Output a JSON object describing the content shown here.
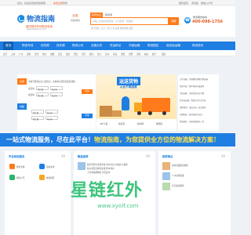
{
  "topbar": {
    "welcome": "您好，欢迎来到物流指南网",
    "links": [
      "免费注册",
      "登录",
      "客服中心"
    ],
    "right_links": [
      "服务首页",
      "手机版",
      "微信公众号",
      "网站导航"
    ]
  },
  "header": {
    "site_name": "物流指南",
    "slogan": "国内物流专线物流查询",
    "url": "www.wlzhinan.com",
    "city": "全国",
    "switch_city": "切换城市",
    "search_tabs": [
      "物流信息",
      "搜货源"
    ],
    "search_placeholder": "请输入出发地/目的地、公司名称、线路等",
    "search_button": "搜索",
    "hotwords": "热门搜索：北京 上海 广州 深圳 物流专线 货运",
    "hotline_label": "物流服务热线",
    "hotline_number": "400-098-1756",
    "hotline_icon": "phone-icon"
  },
  "nav": {
    "items": [
      "首页",
      "物流专线",
      "找货源",
      "找车源",
      "物流公司",
      "全国大件",
      "货运网点",
      "冷链运输",
      "物流园区",
      "危险品运输",
      "物流资讯"
    ]
  },
  "subnav": {
    "items": [
      "北京",
      "上海",
      "广州",
      "深圳",
      "天津",
      "杭州",
      "成都",
      "武汉",
      "重庆",
      "西安",
      "南京",
      "郑州",
      "长沙",
      "苏州",
      "青岛",
      "沈阳",
      "合肥",
      "济南",
      "福州",
      "厦门",
      "更多"
    ]
  },
  "form": {
    "tab1": "货源",
    "tab2": "线路",
    "hint": "请填写物流起点以及终点，系统将为您匹配最优线路",
    "from_label": "发货地",
    "to_label": "收货地",
    "province_from": "浙江省",
    "city_from": "杭州市",
    "province_to": "浙江省",
    "city_to": "杭州市",
    "query_button": "查询",
    "query_button2": "查询"
  },
  "banner": {
    "title": "运送货物",
    "subtitle": "从此不再困难",
    "tabs": [
      "APP下载",
      "找货源",
      "找车辆",
      "物流园"
    ]
  },
  "news": {
    "items": [
      "大件运输：不超重不超限货物运输",
      "物流专线：整车零担价格透明",
      "冷链运输：全程温控安全可靠",
      "危险品运输：资质齐全专业车队",
      "国际物流：海运空运一站式服务",
      "仓储配送：城市配送当日达",
      "物流园区：全国百家园区入驻"
    ]
  },
  "strip": {
    "text_before": "一站式物流服务，尽在此平台！",
    "text_highlight": "物流指南，为您提供全方位的物流解决方案！"
  },
  "columns": {
    "col1_title": "平台特色服务",
    "col2_title": "精品推荐",
    "col3_title": "推荐网点",
    "more": "更多",
    "col1_items": [
      "物流专线",
      "货运车源",
      "物流公司",
      "物流园区"
    ],
    "col2_items": [
      "临沂到鄂尔多斯专线 专车直达 时效快 价格低",
      "杭州到西安物流专线 整车零担",
      "上海到成都物流 天天发车"
    ],
    "col3_items": [
      "深圳市鑫顺达物流",
      "广州恒通运输",
      "北京顺达物流"
    ]
  },
  "watermark": {
    "text": "星链红外",
    "url": "www.xyolf.com"
  }
}
